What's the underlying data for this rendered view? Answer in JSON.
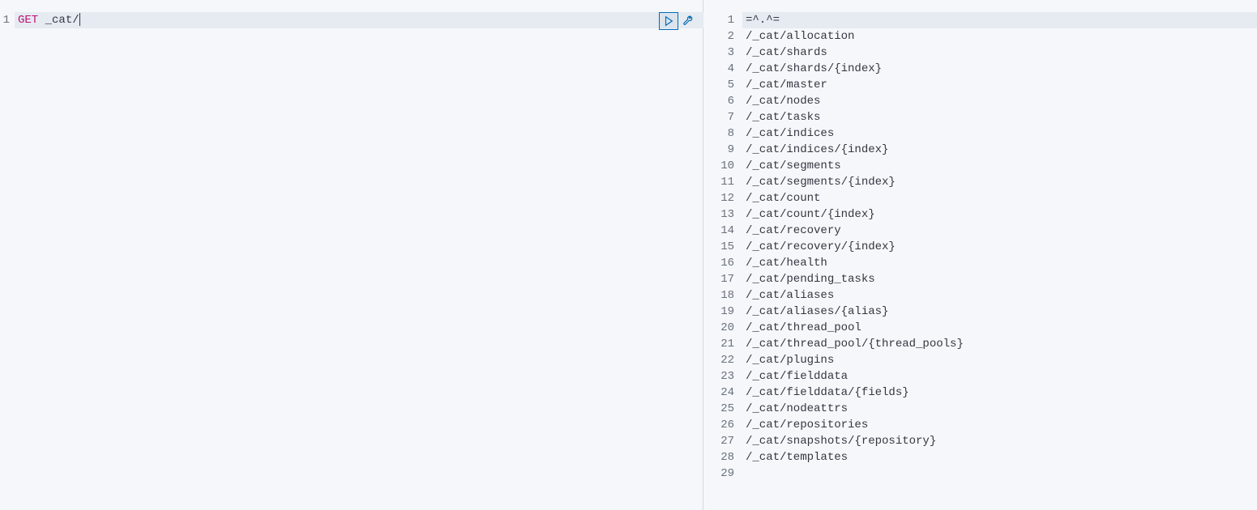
{
  "request": {
    "lineNumber": 1,
    "method": "GET",
    "path": "_cat/"
  },
  "toolbar": {
    "play": "play-icon",
    "wrench": "wrench-icon"
  },
  "response": {
    "lines": [
      "=^.^=",
      "/_cat/allocation",
      "/_cat/shards",
      "/_cat/shards/{index}",
      "/_cat/master",
      "/_cat/nodes",
      "/_cat/tasks",
      "/_cat/indices",
      "/_cat/indices/{index}",
      "/_cat/segments",
      "/_cat/segments/{index}",
      "/_cat/count",
      "/_cat/count/{index}",
      "/_cat/recovery",
      "/_cat/recovery/{index}",
      "/_cat/health",
      "/_cat/pending_tasks",
      "/_cat/aliases",
      "/_cat/aliases/{alias}",
      "/_cat/thread_pool",
      "/_cat/thread_pool/{thread_pools}",
      "/_cat/plugins",
      "/_cat/fielddata",
      "/_cat/fielddata/{fields}",
      "/_cat/nodeattrs",
      "/_cat/repositories",
      "/_cat/snapshots/{repository}",
      "/_cat/templates",
      ""
    ]
  }
}
